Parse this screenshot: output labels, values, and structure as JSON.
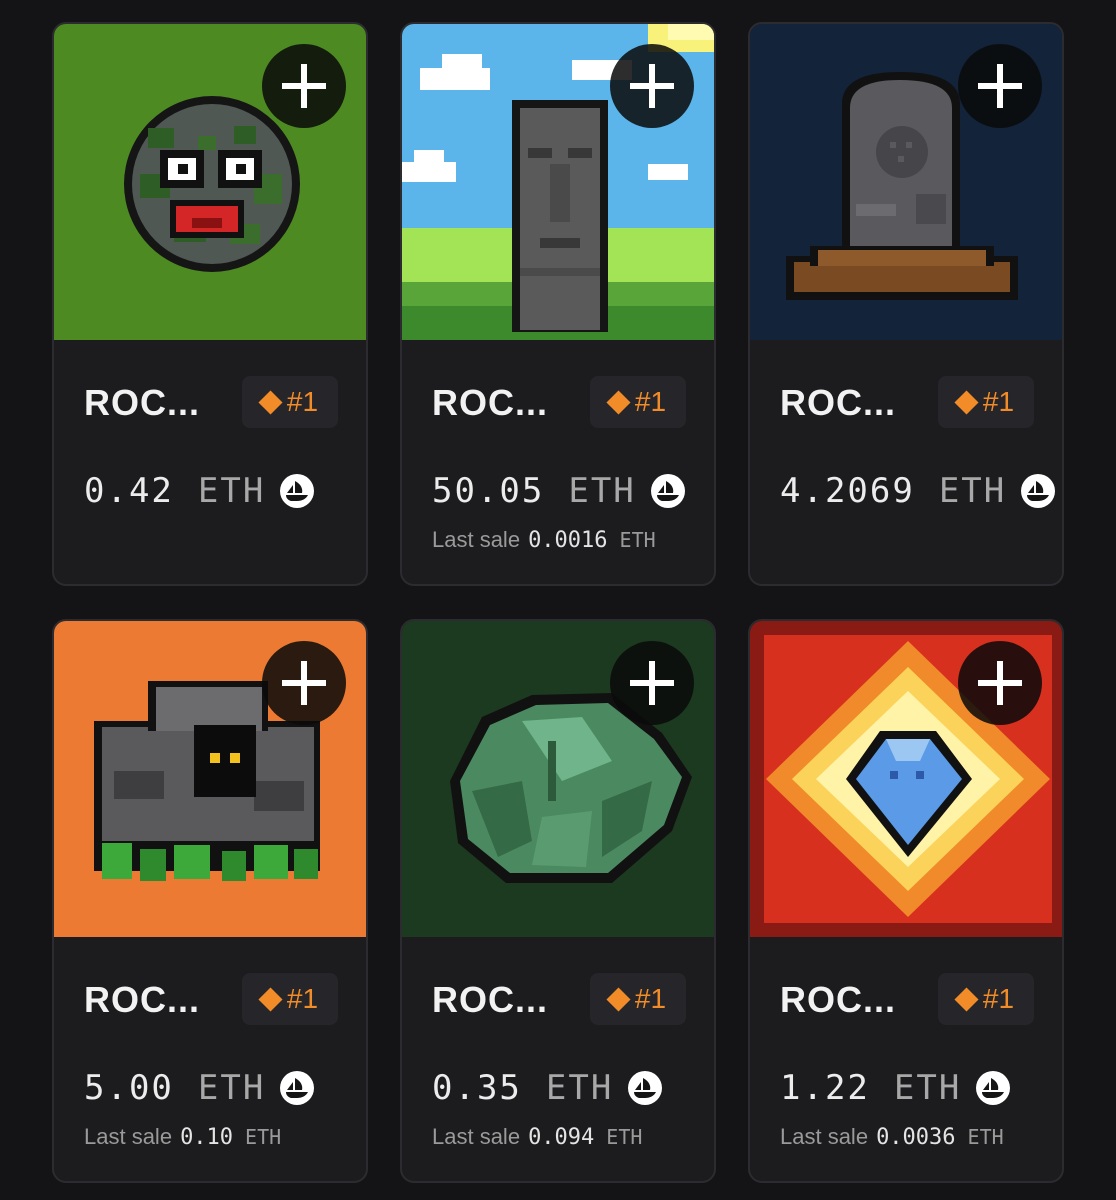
{
  "theme": {
    "background": "#141416",
    "card": "#1c1c1f",
    "rank_accent": "#f28c28"
  },
  "icons": {
    "add": "plus-icon",
    "marketplace": "opensea-icon",
    "rank": "diamond-icon"
  },
  "cards": [
    {
      "title": "ROC...",
      "rank": "#1",
      "price": "0.42",
      "currency": "ETH",
      "art": "rock-face-moss",
      "art_bg": "#4e8a22"
    },
    {
      "title": "ROC...",
      "rank": "#1",
      "price": "50.05",
      "currency": "ETH",
      "last_sale_label": "Last sale",
      "last_sale_value": "0.0016",
      "last_sale_currency": "ETH",
      "art": "moai-statue",
      "art_bg": "#5bb5ea"
    },
    {
      "title": "ROC...",
      "rank": "#1",
      "price": "4.2069",
      "currency": "ETH",
      "art": "tombstone",
      "art_bg": "#12233a"
    },
    {
      "title": "ROC...",
      "rank": "#1",
      "price": "5.00",
      "currency": "ETH",
      "last_sale_label": "Last sale",
      "last_sale_value": "0.10",
      "last_sale_currency": "ETH",
      "art": "rock-cave-creature",
      "art_bg": "#ec7a32"
    },
    {
      "title": "ROC...",
      "rank": "#1",
      "price": "0.35",
      "currency": "ETH",
      "last_sale_label": "Last sale",
      "last_sale_value": "0.094",
      "last_sale_currency": "ETH",
      "art": "green-crystal-rock",
      "art_bg": "#1c3a1f"
    },
    {
      "title": "ROC...",
      "rank": "#1",
      "price": "1.22",
      "currency": "ETH",
      "last_sale_label": "Last sale",
      "last_sale_value": "0.0036",
      "last_sale_currency": "ETH",
      "art": "blue-diamond-glow",
      "art_bg": "#d8301e"
    }
  ]
}
